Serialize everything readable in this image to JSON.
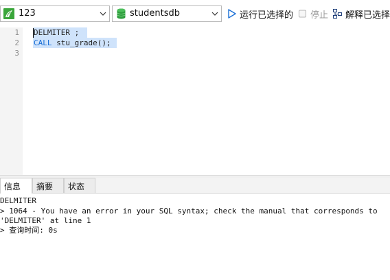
{
  "toolbar": {
    "connection": "123",
    "database": "studentsdb",
    "run_label": "运行已选择的",
    "stop_label": "停止",
    "explain_label": "解释已选择的"
  },
  "editor": {
    "line_numbers": [
      "1",
      "2",
      "3"
    ],
    "lines": {
      "line1": "DELMITER ;",
      "line2_keyword": "CALL",
      "line2_rest": " stu_grade();"
    }
  },
  "tabs": [
    "信息",
    "摘要",
    "状态"
  ],
  "output": {
    "lines": [
      "DELMITER",
      "> 1064 - You have an error in your SQL syntax; check the manual that corresponds to",
      "'DELMITER' at line 1",
      "> 查询时间: 0s"
    ]
  },
  "colors": {
    "accent": "#1a6fd6",
    "selection": "#cfe3fb",
    "db_icon": "#2e9e3d",
    "connection_icon": "#3aa63a"
  },
  "icons": {
    "connection": "mysql-connection-icon",
    "database": "database-icon",
    "run": "play-icon",
    "stop": "stop-checkbox-icon",
    "explain": "explain-icon"
  }
}
